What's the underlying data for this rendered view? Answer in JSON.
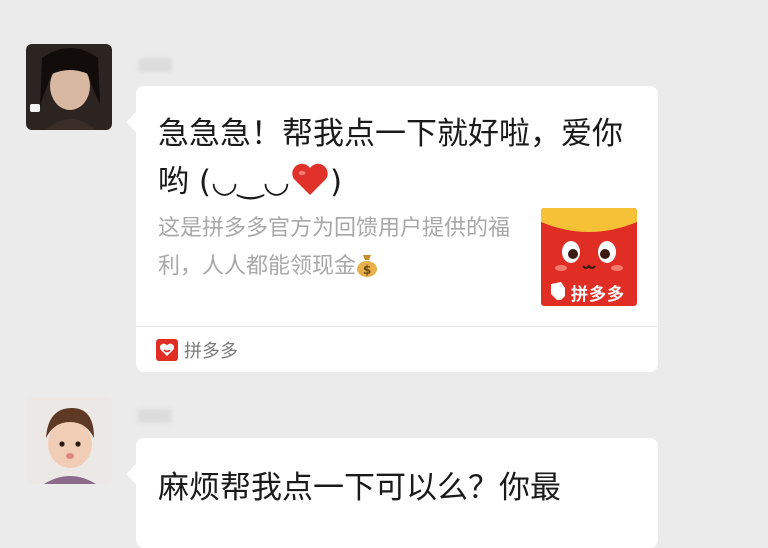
{
  "messages": [
    {
      "title_part1": "急急急！帮我点一下就好啦，爱你哟 (◡‿◡",
      "title_part2": ")",
      "description_part1": "这是拼多多官方为回馈用户提供的福利，人人都能领现金",
      "thumbnail_label": "拼多多",
      "source_label": "拼多多"
    },
    {
      "text": "麻烦帮我点一下可以么？你最"
    }
  ],
  "icons": {
    "heart": "red-heart-emoji",
    "money": "money-bag-emoji",
    "source": "pinduoduo-logo",
    "thumbnail": "pinduoduo-red-envelope"
  },
  "colors": {
    "background": "#ebebeb",
    "card": "#ffffff",
    "title_text": "#1a1a1a",
    "desc_text": "#a8a8a8",
    "pdd_red": "#e02e24",
    "pdd_yellow": "#f7c137"
  }
}
